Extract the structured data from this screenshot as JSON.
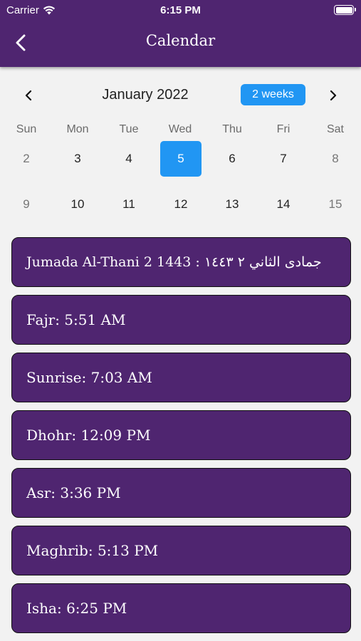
{
  "status_bar": {
    "carrier": "Carrier",
    "time": "6:15 PM"
  },
  "nav": {
    "title": "Calendar",
    "back_icon": "chevron-left-icon"
  },
  "calendar": {
    "month": "January 2022",
    "format_button": "2 weeks",
    "weekdays": [
      "Sun",
      "Mon",
      "Tue",
      "Wed",
      "Thu",
      "Fri",
      "Sat"
    ],
    "weeks": [
      [
        "2",
        "3",
        "4",
        "5",
        "6",
        "7",
        "8"
      ],
      [
        "9",
        "10",
        "11",
        "12",
        "13",
        "14",
        "15"
      ]
    ],
    "selected_day": "5",
    "selected_color": "#2196f3"
  },
  "cards": {
    "hijri_date": "Jumada Al-Thani 2 1443 : جمادى الثاني ٢ ١٤٤٣",
    "fajr": "Fajr: 5:51 AM",
    "sunrise": "Sunrise: 7:03 AM",
    "dhohr": "Dhohr: 12:09 PM",
    "asr": "Asr: 3:36 PM",
    "maghrib": "Maghrib: 5:13 PM",
    "isha": "Isha: 6:25 PM"
  },
  "colors": {
    "header": "#4f2570",
    "card": "#4f2570",
    "accent": "#2196f3"
  }
}
